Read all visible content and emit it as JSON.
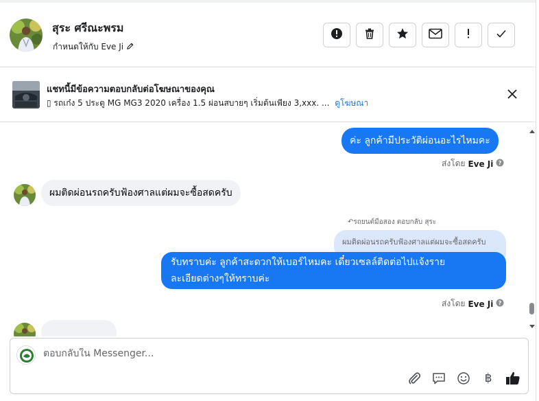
{
  "header": {
    "name": "สุระ ศรีณะพรม",
    "assigned_label": "กำหนดให้กับ Eve Ji",
    "actions": [
      "mark-spam",
      "delete",
      "star",
      "mark-unread",
      "flag",
      "mark-done"
    ]
  },
  "ad_context": {
    "title": "แชทนี้มีข้อความตอบกลับต่อโฆษณาของคุณ",
    "description": "▯ รถเก๋ง 5 ประตู MG MG3 2020 เครื่อง 1.5 ผ่อนสบายๆ เริ่มต้นเพียง 3,xxx. ...",
    "link": "ดูโฆษณา"
  },
  "messages": {
    "out1": {
      "text": "ค่ะ ลูกค้ามีประวัติผ่อนอะไรไหมคะ"
    },
    "sent1": {
      "prefix": "ส่งโดย",
      "agent": "Eve Ji"
    },
    "in1": {
      "text": "ผมติดผ่อนรถครับฟ้องศาลแต่ผมจะซื้อสดครับ"
    },
    "reply_meta": "↶รถยนต์มือสอง ตอบกลับ สุระ",
    "quote": "ผมติดผ่อนรถครับฟ้องศาลแต่ผมจะซื้อสดครับ",
    "out2": {
      "line1": "รับทราบค่ะ ลูกค้าสะดวกให้เบอร์ไหมคะ เดี๋ยวเซลล์ติดต่อไปแจ้งราย",
      "line2": "ละเอียดต่างๆให้ทราบค่ะ"
    },
    "sent2": {
      "prefix": "ส่งโดย",
      "agent": "Eve Ji"
    }
  },
  "composer": {
    "placeholder": "ตอบกลับใน Messenger...",
    "tools": [
      "attach-icon",
      "saved-reply-icon",
      "emoji-icon",
      "baht-icon",
      "like-icon"
    ],
    "baht_symbol": "฿"
  },
  "colors": {
    "accent": "#1877f2",
    "incoming_bubble": "#f0f2f5",
    "quote_bubble": "#dbe7fb"
  }
}
